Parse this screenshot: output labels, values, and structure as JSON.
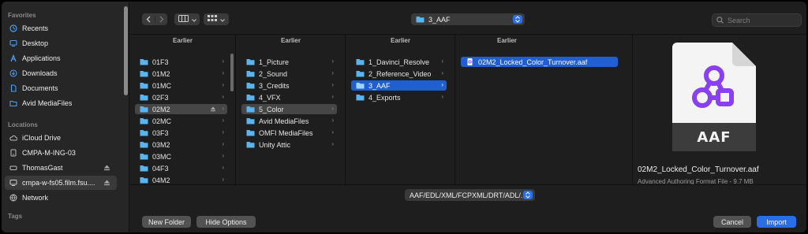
{
  "sidebar": {
    "favorites_heading": "Favorites",
    "favorites": [
      {
        "label": "Recents",
        "icon": "clock-icon"
      },
      {
        "label": "Desktop",
        "icon": "desktop-icon"
      },
      {
        "label": "Applications",
        "icon": "applications-icon"
      },
      {
        "label": "Downloads",
        "icon": "download-icon"
      },
      {
        "label": "Documents",
        "icon": "document-icon"
      },
      {
        "label": "Avid MediaFiles",
        "icon": "folder-icon"
      }
    ],
    "locations_heading": "Locations",
    "locations": [
      {
        "label": "iCloud Drive",
        "icon": "cloud-icon"
      },
      {
        "label": "CMPA-M-ING-03",
        "icon": "drive-icon"
      },
      {
        "label": "ThomasGast",
        "icon": "disk-icon",
        "eject": true
      },
      {
        "label": "cmpa-w-fs05.film.fsu....",
        "icon": "server-icon",
        "eject": true,
        "selected": true
      },
      {
        "label": "Network",
        "icon": "network-icon"
      }
    ],
    "tags_heading": "Tags"
  },
  "toolbar": {
    "back_icon": "chevron-left-icon",
    "forward_icon": "chevron-right-icon",
    "view_icon": "column-view-icon",
    "group_icon": "grid-icon",
    "path_label": "3_AAF",
    "search_placeholder": "Search"
  },
  "columns": [
    {
      "heading": "Earlier",
      "items": [
        {
          "label": "01F3"
        },
        {
          "label": "01M2"
        },
        {
          "label": "01MC"
        },
        {
          "label": "02F3"
        },
        {
          "label": "02M2",
          "selected": "grey",
          "eject": true
        },
        {
          "label": "02MC"
        },
        {
          "label": "03F3"
        },
        {
          "label": "03M2"
        },
        {
          "label": "03MC"
        },
        {
          "label": "04F3"
        },
        {
          "label": "04M2"
        }
      ]
    },
    {
      "heading": "Earlier",
      "items": [
        {
          "label": "1_Picture"
        },
        {
          "label": "2_Sound"
        },
        {
          "label": "3_Credits"
        },
        {
          "label": "4_VFX"
        },
        {
          "label": "5_Color",
          "selected": "grey"
        },
        {
          "label": "Avid MediaFiles"
        },
        {
          "label": "OMFI MediaFiles"
        },
        {
          "label": "Unity Attic"
        }
      ]
    },
    {
      "heading": "Earlier",
      "items": [
        {
          "label": "1_Davinci_Resolve"
        },
        {
          "label": "2_Reference_Video"
        },
        {
          "label": "3_AAF",
          "selected": "blue"
        },
        {
          "label": "4_Exports"
        }
      ]
    },
    {
      "heading": "Earlier",
      "items": [
        {
          "label": "02M2_Locked_Color_Turnover.aaf",
          "selected": "blue",
          "file": true
        }
      ]
    }
  ],
  "preview": {
    "icon_label": "AAF",
    "file_name": "02M2_Locked_Color_Turnover.aaf",
    "file_kind": "Advanced Authoring Format File - 9.7 MB",
    "accent": "#8a3ff0"
  },
  "footer": {
    "filter_label": "AAF/EDL/XML/FCPXML/DRT/ADL/...",
    "new_folder": "New Folder",
    "hide_options": "Hide Options",
    "cancel": "Cancel",
    "import": "Import"
  },
  "colors": {
    "selection_blue": "#1f5fd1",
    "folder_blue": "#5ab4ee",
    "primary_button": "#2b6de8"
  }
}
